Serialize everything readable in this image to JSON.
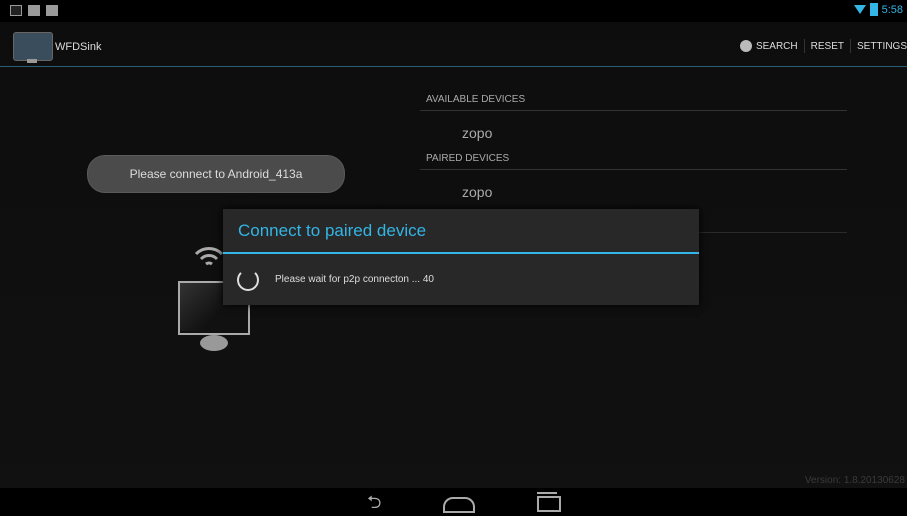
{
  "status_bar": {
    "left_icons": [
      "gallery-icon",
      "screen-icon",
      "android-icon"
    ],
    "time": "5:58",
    "wifi_icon": "wifi-icon",
    "battery_icon": "battery-icon",
    "accent": "#33b5e5"
  },
  "action_bar": {
    "app_icon": "wfd-monitor-icon",
    "title": "WFDSink",
    "actions": {
      "search": "SEARCH",
      "reset": "RESET",
      "settings": "SETTINGS"
    }
  },
  "devices": {
    "available_header": "AVAILABLE DEVICES",
    "available": [
      "zopo"
    ],
    "paired_header": "PAIRED DEVICES",
    "paired": [
      "zopo"
    ]
  },
  "toast": "Please connect to Android_413a",
  "dialog": {
    "title": "Connect to paired device",
    "message": "Please wait for p2p connecton ... 40"
  },
  "version": "Version: 1.8.20130628",
  "nav": {
    "back": "back-icon",
    "home": "home-icon",
    "recents": "recents-icon"
  }
}
